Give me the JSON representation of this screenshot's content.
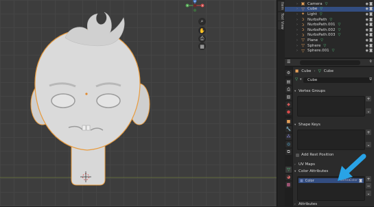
{
  "viewport_tabs": {
    "item": "Item",
    "tool": "Tool",
    "view": "View"
  },
  "nav_gizmo": {
    "z": "Z",
    "y": "Y",
    "x": "X"
  },
  "outliner": {
    "rows": [
      {
        "label": "Camera",
        "icon": "camera-object-icon",
        "icon_color": "#e6a15a",
        "selected": false
      },
      {
        "label": "Cube",
        "icon": "mesh-object-icon",
        "icon_color": "#e6a15a",
        "selected": true
      },
      {
        "label": "Light",
        "icon": "light-object-icon",
        "icon_color": "#e6a15a",
        "selected": false
      },
      {
        "label": "NurbsPath",
        "icon": "curve-object-icon",
        "icon_color": "#e6a15a",
        "selected": false
      },
      {
        "label": "NurbsPath.001",
        "icon": "curve-object-icon",
        "icon_color": "#e6a15a",
        "selected": false
      },
      {
        "label": "NurbsPath.002",
        "icon": "curve-object-icon",
        "icon_color": "#e6a15a",
        "selected": false
      },
      {
        "label": "NurbsPath.003",
        "icon": "curve-object-icon",
        "icon_color": "#e6a15a",
        "selected": false
      },
      {
        "label": "Plane",
        "icon": "mesh-object-icon",
        "icon_color": "#e6a15a",
        "selected": false
      },
      {
        "label": "Sphere",
        "icon": "mesh-object-icon",
        "icon_color": "#e6a15a",
        "selected": false
      },
      {
        "label": "Sphere.001",
        "icon": "mesh-object-icon",
        "icon_color": "#e6a15a",
        "selected": false
      }
    ]
  },
  "properties": {
    "breadcrumb": {
      "object": "Cube",
      "data": "Cube"
    },
    "mesh_name": "Cube",
    "sections": {
      "vertex_groups": "Vertex Groups",
      "shape_keys": "Shape Keys",
      "add_rest_position": "Add Rest Position",
      "uv_maps": "UV Maps",
      "color_attributes": "Color Attributes",
      "attributes": "Attributes"
    },
    "color_attribute_item": {
      "name": "Color",
      "domain": "Vertex",
      "type": "Color"
    }
  },
  "colors": {
    "accent": "#29a3e6",
    "selection": "#334d80",
    "outline": "#e89a3c"
  }
}
